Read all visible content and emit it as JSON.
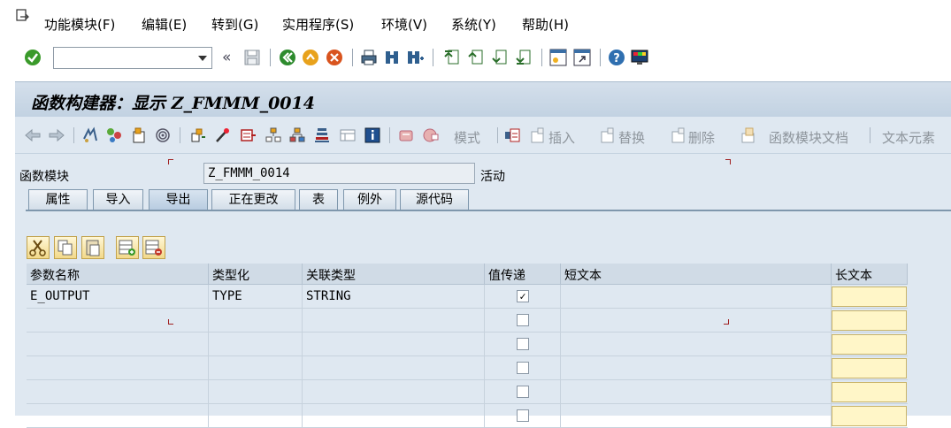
{
  "menu": {
    "items": [
      "功能模块(F)",
      "编辑(E)",
      "转到(G)",
      "实用程序(S)",
      "环境(V)",
      "系统(Y)",
      "帮助(H)"
    ],
    "underline_chars": [
      "F",
      "E",
      "G",
      "S",
      "V",
      "Y",
      "H"
    ]
  },
  "toolbar": {
    "command_field_value": "",
    "collapse_symbol": "«"
  },
  "title": "函数构建器：显示 Z_FMMM_0014",
  "app_toolbar": {
    "mode_label": "模式",
    "insert_label": "插入",
    "replace_label": "替换",
    "delete_label": "删除",
    "fm_doc_label": "函数模块文档",
    "text_elements_label": "文本元素"
  },
  "function_module": {
    "label": "函数模块",
    "value": "Z_FMMM_0014",
    "status": "活动"
  },
  "tabs": [
    "属性",
    "导入",
    "导出",
    "正在更改",
    "表",
    "例外",
    "源代码"
  ],
  "active_tab_index": 2,
  "table": {
    "columns": [
      "参数名称",
      "类型化",
      "关联类型",
      "值传递",
      "短文本",
      "长文本"
    ],
    "rows": [
      {
        "param": "E_OUTPUT",
        "typing": "TYPE",
        "assoc": "STRING",
        "pass_by_value": true,
        "short_text": ""
      },
      {
        "param": "",
        "typing": "",
        "assoc": "",
        "pass_by_value": false,
        "short_text": ""
      },
      {
        "param": "",
        "typing": "",
        "assoc": "",
        "pass_by_value": false,
        "short_text": ""
      },
      {
        "param": "",
        "typing": "",
        "assoc": "",
        "pass_by_value": false,
        "short_text": ""
      },
      {
        "param": "",
        "typing": "",
        "assoc": "",
        "pass_by_value": false,
        "short_text": ""
      },
      {
        "param": "",
        "typing": "",
        "assoc": "",
        "pass_by_value": false,
        "short_text": ""
      }
    ]
  },
  "colors": {
    "title_bg": "#c8d6e5",
    "panel_bg": "#dfe8f1",
    "longtext_btn": "#fff6c8"
  }
}
